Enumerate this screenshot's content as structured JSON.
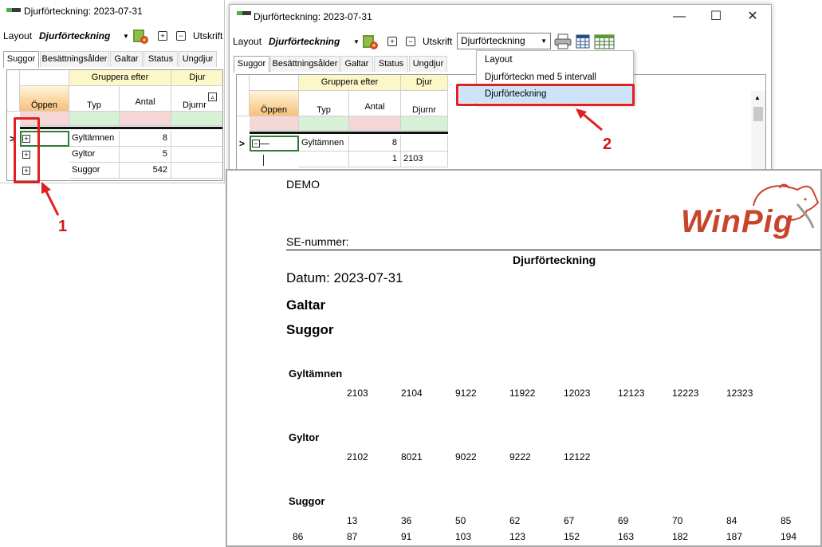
{
  "window_back": {
    "title": "Djurförteckning: 2023-07-31",
    "toolbar": {
      "layout_label": "Layout",
      "layout_value": "Djurförteckning",
      "expand_btn": "+",
      "collapse_btn": "−",
      "print_label": "Utskrift"
    },
    "tabs": [
      "Suggor",
      "Besättningsålder",
      "Galtar",
      "Status",
      "Ungdjur"
    ],
    "grid": {
      "group_header": "Gruppera efter",
      "djur_header": "Djur",
      "open_header": "Öppen",
      "col_typ": "Typ",
      "col_antal": "Antal",
      "col_djurnr": "Djurnr",
      "rows": [
        {
          "typ": "Gyltämnen",
          "antal": "8"
        },
        {
          "typ": "Gyltor",
          "antal": "5"
        },
        {
          "typ": "Suggor",
          "antal": "542"
        }
      ]
    }
  },
  "window_front": {
    "title": "Djurförteckning: 2023-07-31",
    "controls": {
      "minimize": "—",
      "maximize": "☐",
      "close": "✕"
    },
    "toolbar": {
      "layout_label": "Layout",
      "layout_value": "Djurförteckning",
      "expand_btn": "+",
      "collapse_btn": "−",
      "print_label": "Utskrift",
      "combo_value": "Djurförteckning"
    },
    "tabs": [
      "Suggor",
      "Besättningsålder",
      "Galtar",
      "Status",
      "Ungdjur"
    ],
    "grid": {
      "group_header": "Gruppera efter",
      "djur_header": "Djur",
      "open_header": "Öppen",
      "col_typ": "Typ",
      "col_antal": "Antal",
      "col_djurnr": "Djurnr",
      "row1": {
        "typ": "Gyltämnen",
        "antal": "8"
      },
      "row2": {
        "antal": "1",
        "djurnr": "2103"
      }
    },
    "dropdown_items": [
      "Layout",
      "Djurförteckn med 5 intervall",
      "Djurförteckning"
    ]
  },
  "report": {
    "company": "DEMO",
    "logo_text": "WinPig",
    "se_label": "SE-nummer:",
    "title": "Djurförteckning",
    "date": "Datum: 2023-07-31",
    "section_galtar": "Galtar",
    "section_suggor": "Suggor",
    "groups": [
      {
        "name": "Gyltämnen",
        "lines": [
          [
            "2103",
            "2104",
            "9122",
            "11922",
            "12023",
            "12123",
            "12223",
            "12323"
          ]
        ]
      },
      {
        "name": "Gyltor",
        "lines": [
          [
            "2102",
            "8021",
            "9022",
            "9222",
            "12122"
          ]
        ]
      },
      {
        "name": "Suggor",
        "lines": [
          [
            "13",
            "36",
            "50",
            "62",
            "67",
            "69",
            "70",
            "84",
            "85"
          ],
          [
            "86",
            "87",
            "91",
            "103",
            "123",
            "152",
            "163",
            "182",
            "187",
            "194"
          ]
        ]
      }
    ]
  },
  "annotations": {
    "callout_1": "1",
    "callout_2": "2"
  },
  "colors": {
    "accent_red": "#e02020",
    "highlight": "#cce4f7",
    "logo_red": "#c8452b",
    "logo_gray": "#9a9a9a"
  }
}
